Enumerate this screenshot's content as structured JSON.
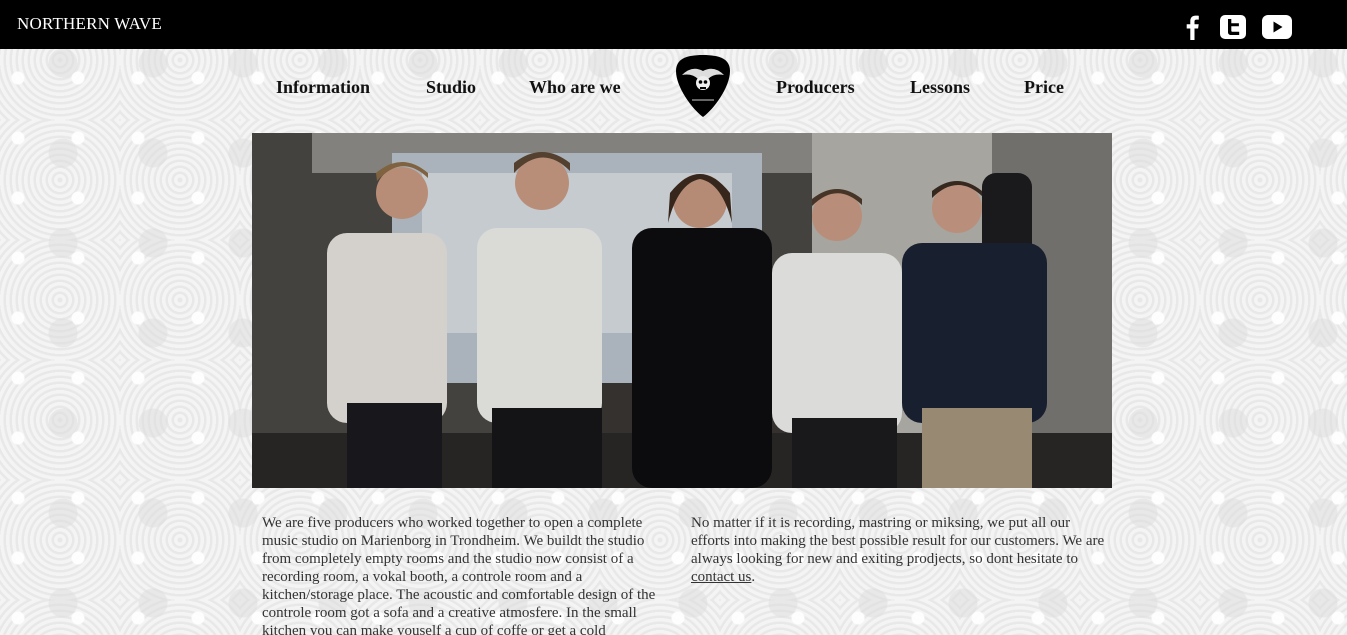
{
  "header": {
    "site_title": "NORTHERN WAVE",
    "social": [
      {
        "icon": "facebook-icon"
      },
      {
        "icon": "twitter-icon"
      },
      {
        "icon": "youtube-icon"
      }
    ]
  },
  "nav": {
    "items": [
      {
        "label": "Information"
      },
      {
        "label": "Studio"
      },
      {
        "label": "Who are we"
      },
      {
        "label": "Producers"
      },
      {
        "label": "Lessons"
      },
      {
        "label": "Price"
      }
    ],
    "logo_icon": "guitar-pick-logo-icon"
  },
  "hero": {
    "image_icon": "band-photo"
  },
  "content": {
    "col1": "We are five producers who worked together to open a complete music studio on Marienborg in Trondheim. We buildt the studio from completely empty rooms and the studio now consist of a recording room, a vokal booth, a controle room and a kitchen/storage place. The acoustic and comfortable design of the controle room got a sofa and a creative atmosfere. In the small kitchen you can make youself a cup of coffe or get a cold",
    "col2_text": "No matter if it is recording, mastring or miksing, we put all our efforts into making the best possible result for our customers. We are always looking for new and exiting prodjects, so dont hesitate to",
    "col2_link": "contact us",
    "col2_end": "."
  },
  "colors": {
    "topbar": "#000000",
    "text": "#333333",
    "nav_text": "#111111"
  }
}
